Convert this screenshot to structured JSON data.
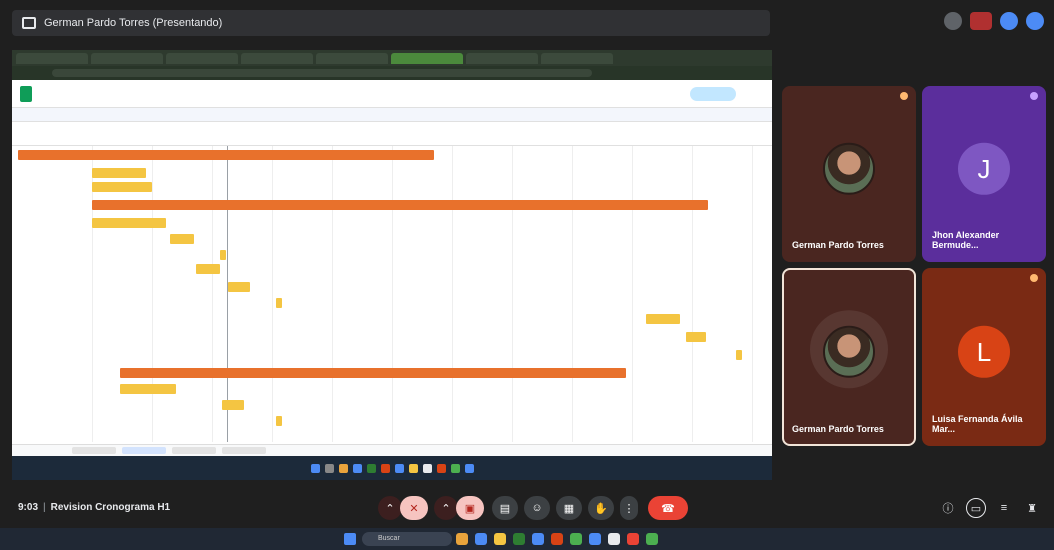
{
  "window": {
    "title": "German Pardo Torres (Presentando)"
  },
  "colors": {
    "end_call": "#ea4335",
    "gantt_orange": "#e8712c",
    "gantt_yellow": "#f4c542"
  },
  "participants": [
    {
      "name": "German Pardo Torres",
      "initial": "",
      "bg": "#4a2620"
    },
    {
      "name": "Jhon Alexander Bermude...",
      "initial": "J",
      "bg": "#5b2e9c",
      "avatar_color": "#7e57c2"
    },
    {
      "name": "German Pardo Torres",
      "initial": "",
      "bg": "#4a2620"
    },
    {
      "name": "Luisa Fernanda Ávila Mar...",
      "initial": "L",
      "bg": "#7a2a14",
      "avatar_color": "#d84315"
    }
  ],
  "meeting": {
    "time": "9:03",
    "name": "Revision Cronograma H1"
  },
  "taskbar": {
    "search_placeholder": "Buscar"
  }
}
